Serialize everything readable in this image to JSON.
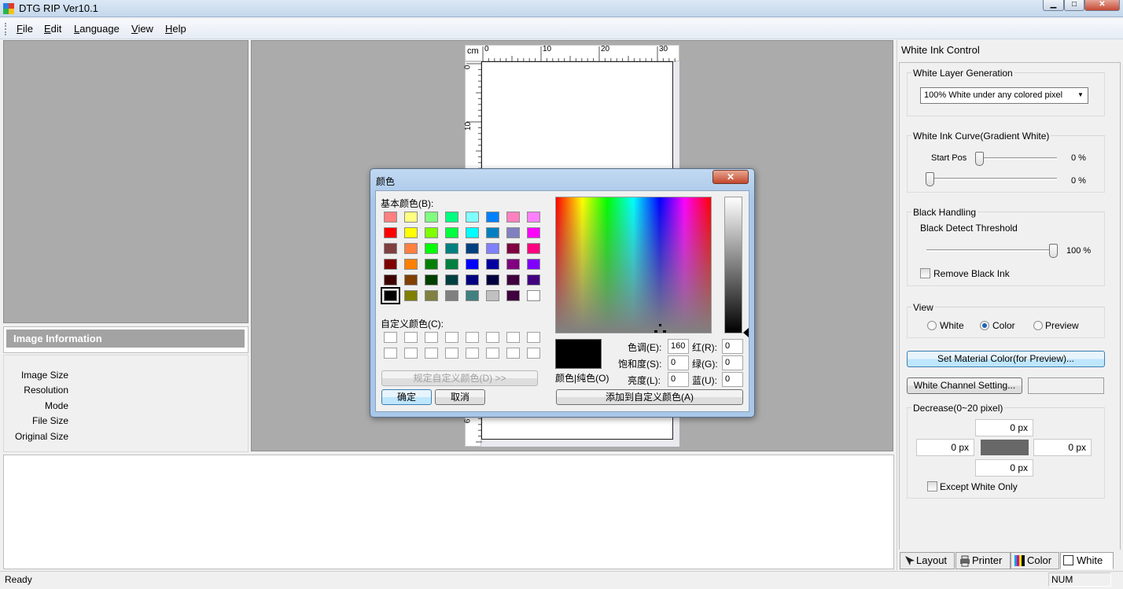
{
  "app": {
    "title": "DTG RIP Ver10.1",
    "window_controls": {
      "minimize": "▁",
      "maximize": "□",
      "close": "✕"
    }
  },
  "menu": [
    "File",
    "Edit",
    "Language",
    "View",
    "Help"
  ],
  "image_info": {
    "header": "Image Information",
    "labels": [
      "Image Size",
      "Resolution",
      "Mode",
      "File Size",
      "Original Size"
    ]
  },
  "ruler": {
    "unit": "cm",
    "top_ticks": [
      "0",
      "10",
      "20",
      "30"
    ],
    "left_ticks": [
      "0",
      "10",
      "6"
    ]
  },
  "status": {
    "text": "Ready",
    "num": "NUM"
  },
  "white_ink": {
    "title": "White Ink Control",
    "layer_group": "White Layer Generation",
    "layer_mode": "100% White under any colored pixel",
    "curve_group": "White Ink Curve(Gradient White)",
    "start_pos_label": "Start Pos",
    "start_pos_value": "0 %",
    "end_value": "0 %",
    "start_pos_fraction": 0,
    "black_group": "Black Handling",
    "black_threshold_label": "Black Detect Threshold",
    "black_threshold_value": "100 %",
    "black_threshold_fraction": 1,
    "remove_black_label": "Remove Black Ink",
    "view_group": "View",
    "view_options": [
      "White",
      "Color",
      "Preview"
    ],
    "view_selected": "Color",
    "material_button": "Set Material Color(for Preview)...",
    "channel_button": "White Channel Setting...",
    "decrease_group": "Decrease(0~20 pixel)",
    "decrease_top": "0 px",
    "decrease_left": "0 px",
    "decrease_right": "0 px",
    "decrease_bottom": "0 px",
    "except_label": "Except White Only"
  },
  "tabs": [
    "Layout",
    "Printer",
    "Color",
    "White"
  ],
  "color_dialog": {
    "title": "颜色",
    "close": "✕",
    "basic_label": "基本颜色(B):",
    "custom_label": "自定义颜色(C):",
    "define_button": "规定自定义颜色(D) >>",
    "ok_button": "确定",
    "cancel_button": "取消",
    "solid_label": "颜色|纯色(O)",
    "add_button": "添加到自定义颜色(A)",
    "hue_label": "色调(E):",
    "hue": "160",
    "sat_label": "饱和度(S):",
    "sat": "0",
    "lum_label": "亮度(L):",
    "lum": "0",
    "red_label": "红(R):",
    "red": "0",
    "green_label": "绿(G):",
    "green": "0",
    "blue_label": "蓝(U):",
    "blue": "0",
    "basic_colors": [
      "#ff8080",
      "#ffff80",
      "#80ff80",
      "#00ff80",
      "#80ffff",
      "#0080ff",
      "#ff80c0",
      "#ff80ff",
      "#ff0000",
      "#ffff00",
      "#80ff00",
      "#00ff40",
      "#00ffff",
      "#0080c0",
      "#8080c0",
      "#ff00ff",
      "#804040",
      "#ff8040",
      "#00ff00",
      "#008080",
      "#004080",
      "#8080ff",
      "#800040",
      "#ff0080",
      "#800000",
      "#ff8000",
      "#008000",
      "#008040",
      "#0000ff",
      "#0000a0",
      "#800080",
      "#8000ff",
      "#400000",
      "#804000",
      "#004000",
      "#004040",
      "#000080",
      "#000040",
      "#400040",
      "#400080",
      "#000000",
      "#808000",
      "#808040",
      "#808080",
      "#408080",
      "#c0c0c0",
      "#400040",
      "#ffffff"
    ],
    "selected_index": 40,
    "current_color": "#000000"
  }
}
